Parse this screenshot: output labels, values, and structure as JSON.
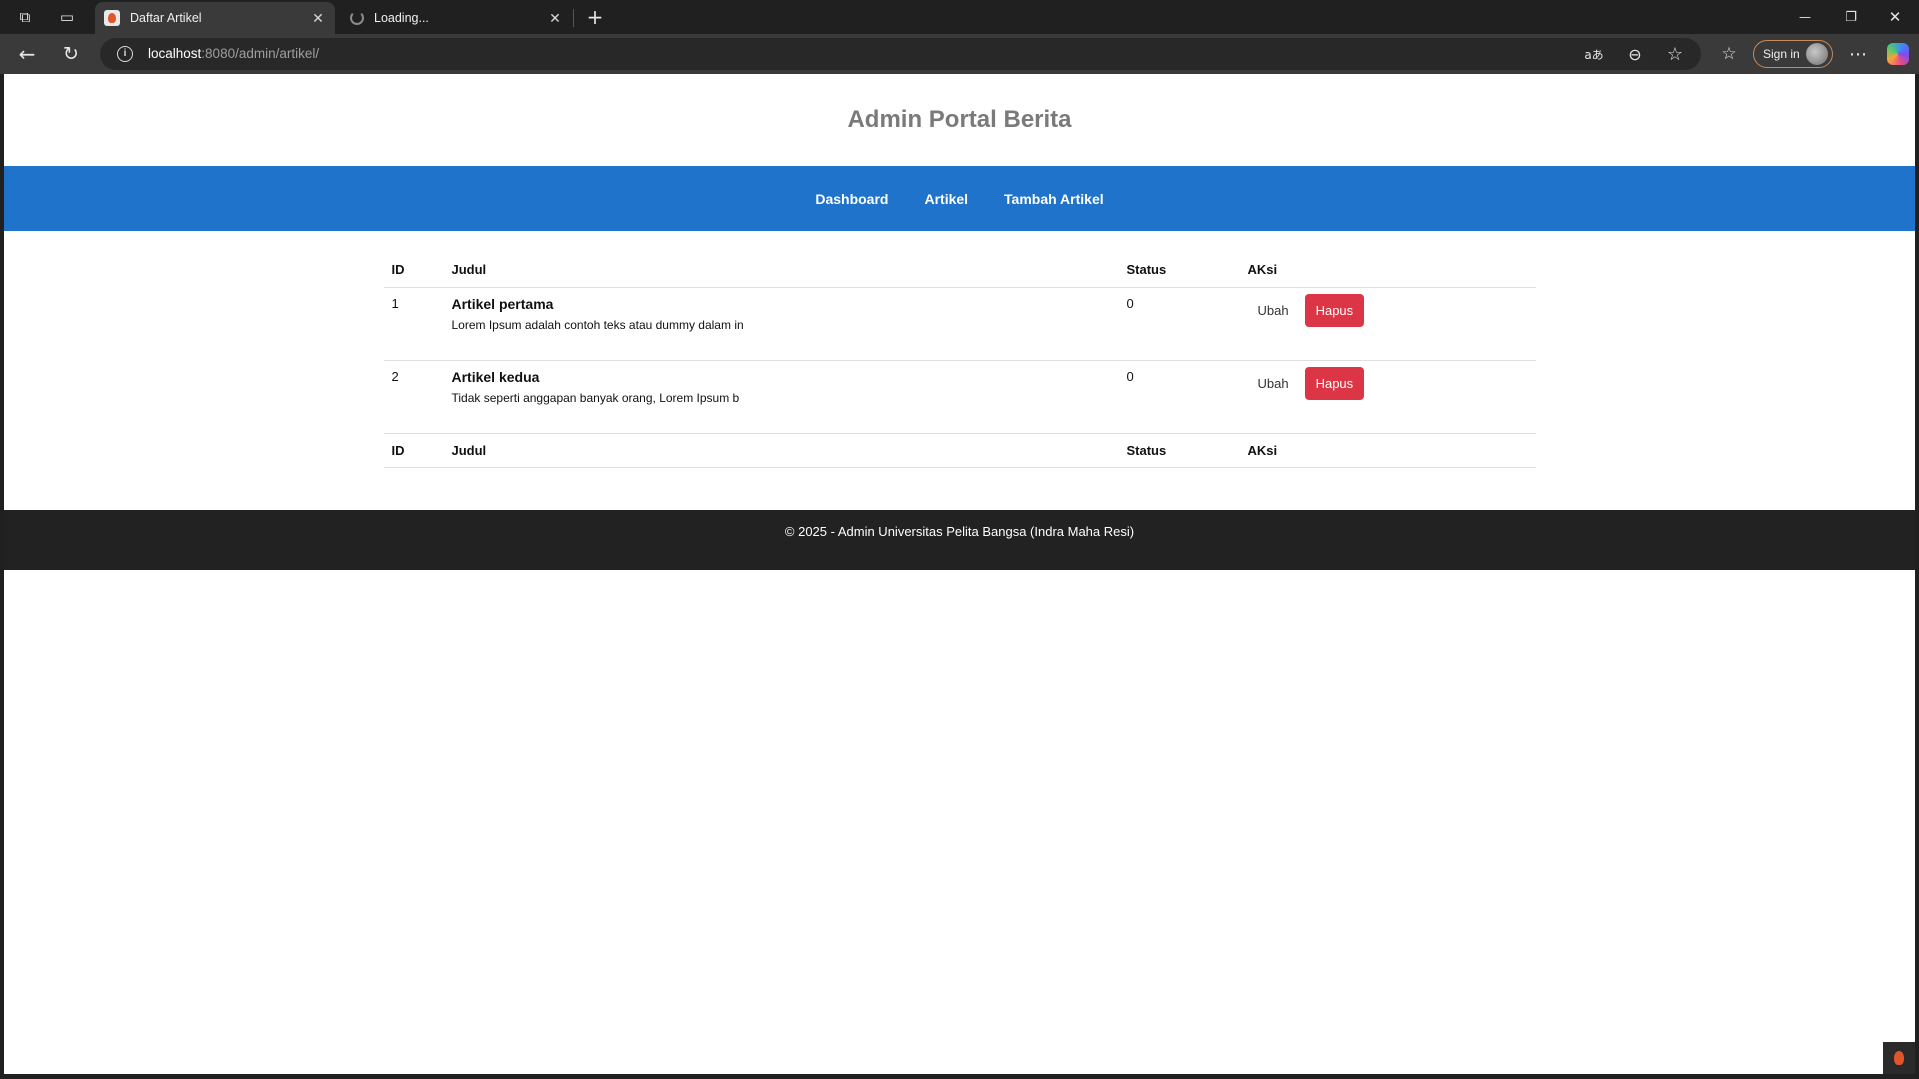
{
  "browser": {
    "tabs": [
      {
        "title": "Daftar Artikel",
        "active": true
      },
      {
        "title": "Loading...",
        "active": false
      }
    ],
    "tab_close": "✕",
    "new_tab": "+",
    "url_host": "localhost",
    "url_rest": ":8080/admin/artikel/",
    "sign_in_label": "Sign in",
    "window_controls": {
      "minimize": "—",
      "restore": "❐",
      "close": "✕"
    },
    "icons": {
      "workspaces": "⧉",
      "tab_actions": "▭",
      "back": "←",
      "reload": "↻",
      "read_aloud": "aあ",
      "zoom": "⊖",
      "favorite": "☆",
      "favorites": "☆",
      "more": "⋯"
    }
  },
  "site": {
    "title": "Admin Portal Berita",
    "nav": [
      "Dashboard",
      "Artikel",
      "Tambah Artikel"
    ],
    "footer": "© 2025 - Admin Universitas Pelita Bangsa (Indra Maha Resi)"
  },
  "table": {
    "headers": [
      "ID",
      "Judul",
      "Status",
      "AKsi"
    ],
    "rows": [
      {
        "id": "1",
        "title": "Artikel pertama",
        "excerpt": "Lorem Ipsum adalah contoh teks atau dummy dalam in",
        "status": "0",
        "edit": "Ubah",
        "delete": "Hapus"
      },
      {
        "id": "2",
        "title": "Artikel kedua",
        "excerpt": "Tidak seperti anggapan banyak orang, Lorem Ipsum b",
        "status": "0",
        "edit": "Ubah",
        "delete": "Hapus"
      }
    ]
  },
  "colors": {
    "nav_bg": "#1f73cb",
    "delete_button": "#dc3545",
    "footer_bg": "#222222",
    "title_text": "#7a7a7a"
  }
}
